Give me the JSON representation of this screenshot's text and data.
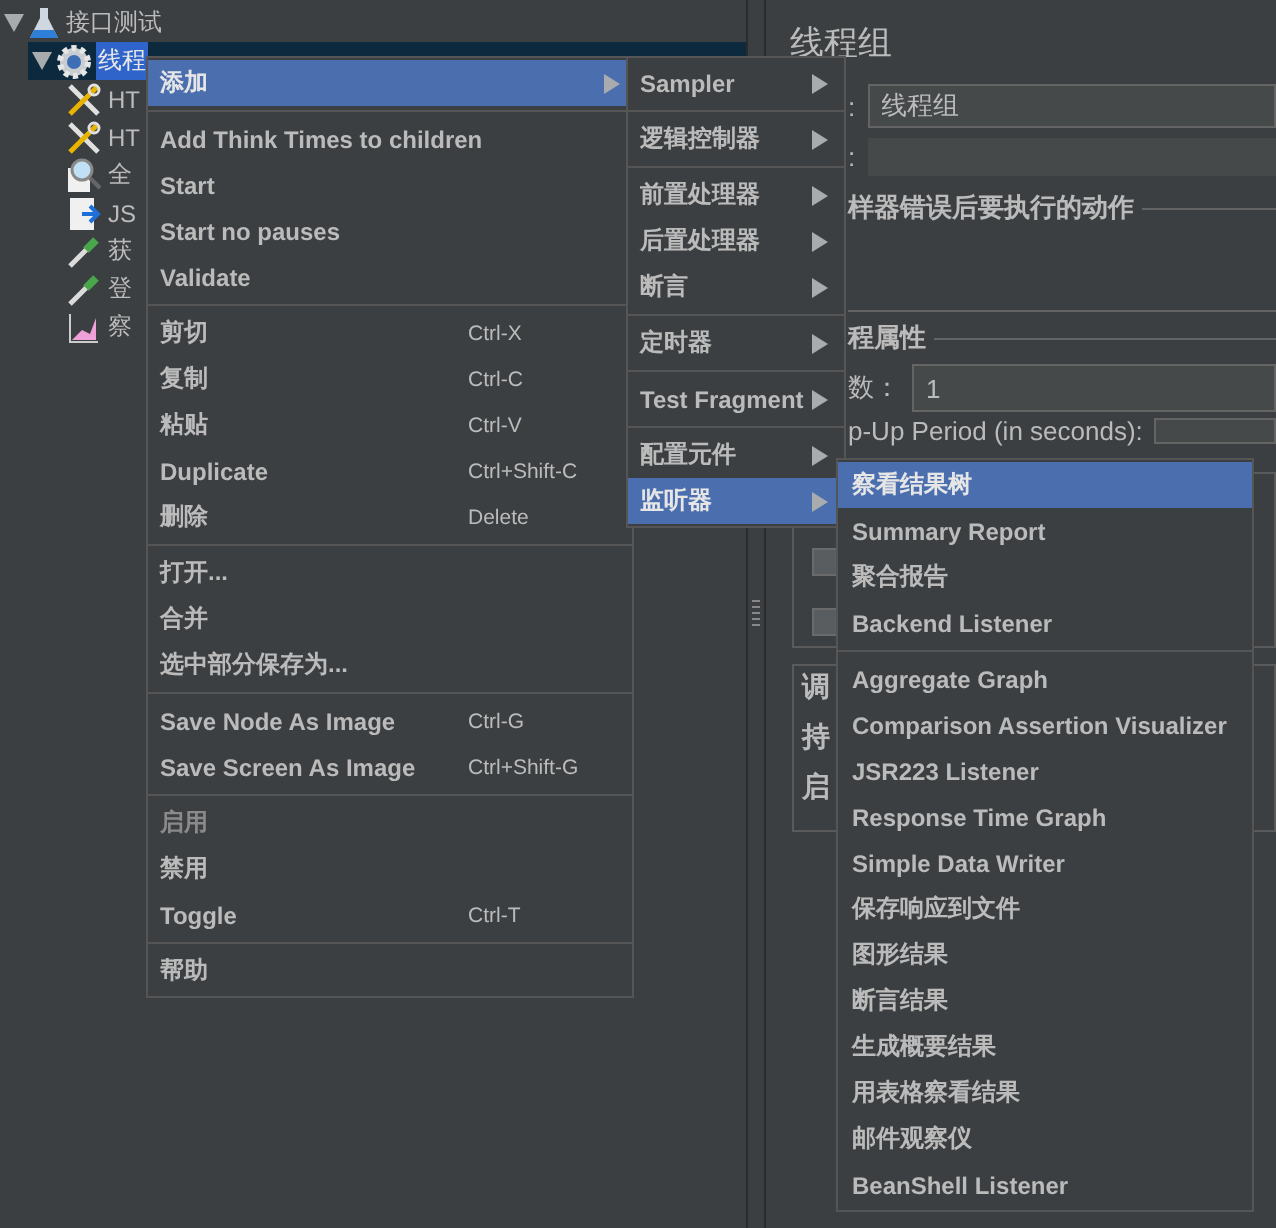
{
  "tree": [
    {
      "label": "接口测试",
      "kind": "plan",
      "expanded": true,
      "selected": false,
      "children": [
        {
          "label": "线程",
          "kind": "thread-group",
          "expanded": true,
          "selected": true,
          "children": [
            {
              "label": "HT",
              "kind": "sampler",
              "selected": false
            },
            {
              "label": "HT",
              "kind": "sampler",
              "selected": false
            },
            {
              "label": "全",
              "kind": "config",
              "selected": false
            },
            {
              "label": "JS",
              "kind": "processor",
              "selected": false
            },
            {
              "label": "获",
              "kind": "extractor",
              "selected": false
            },
            {
              "label": "登",
              "kind": "extractor",
              "selected": false
            },
            {
              "label": "察",
              "kind": "listener",
              "selected": false
            }
          ]
        }
      ]
    }
  ],
  "panel": {
    "title": "线程组",
    "name_label": ":",
    "name_value": "线程组",
    "comment_label": ":",
    "error_section": "样器错误后要执行的动作",
    "props_section": "程属性",
    "threads_label": "数：",
    "threads_value": "1",
    "rampup_label": "p-Up Period (in seconds):",
    "checkboxes": [
      {
        "checked": false
      },
      {
        "checked": false
      }
    ],
    "schedule_labels": [
      "调",
      "持",
      "启"
    ]
  },
  "context_menu": [
    {
      "kind": "item",
      "label": "添加",
      "submenu": true,
      "selected": true,
      "disabled": false
    },
    {
      "kind": "separator"
    },
    {
      "kind": "item",
      "label": "Add Think Times to children",
      "submenu": false,
      "selected": false,
      "disabled": false
    },
    {
      "kind": "item",
      "label": "Start",
      "submenu": false,
      "selected": false,
      "disabled": false
    },
    {
      "kind": "item",
      "label": "Start no pauses",
      "submenu": false,
      "selected": false,
      "disabled": false
    },
    {
      "kind": "item",
      "label": "Validate",
      "submenu": false,
      "selected": false,
      "disabled": false
    },
    {
      "kind": "separator"
    },
    {
      "kind": "item",
      "label": "剪切",
      "shortcut": "Ctrl-X",
      "submenu": false,
      "selected": false,
      "disabled": false
    },
    {
      "kind": "item",
      "label": "复制",
      "shortcut": "Ctrl-C",
      "submenu": false,
      "selected": false,
      "disabled": false
    },
    {
      "kind": "item",
      "label": "粘贴",
      "shortcut": "Ctrl-V",
      "submenu": false,
      "selected": false,
      "disabled": false
    },
    {
      "kind": "item",
      "label": "Duplicate",
      "shortcut": "Ctrl+Shift-C",
      "submenu": false,
      "selected": false,
      "disabled": false
    },
    {
      "kind": "item",
      "label": "删除",
      "shortcut": "Delete",
      "submenu": false,
      "selected": false,
      "disabled": false
    },
    {
      "kind": "separator"
    },
    {
      "kind": "item",
      "label": "打开...",
      "submenu": false,
      "selected": false,
      "disabled": false
    },
    {
      "kind": "item",
      "label": "合并",
      "submenu": false,
      "selected": false,
      "disabled": false
    },
    {
      "kind": "item",
      "label": "选中部分保存为...",
      "submenu": false,
      "selected": false,
      "disabled": false
    },
    {
      "kind": "separator"
    },
    {
      "kind": "item",
      "label": "Save Node As Image",
      "shortcut": "Ctrl-G",
      "submenu": false,
      "selected": false,
      "disabled": false
    },
    {
      "kind": "item",
      "label": "Save Screen As Image",
      "shortcut": "Ctrl+Shift-G",
      "submenu": false,
      "selected": false,
      "disabled": false
    },
    {
      "kind": "separator"
    },
    {
      "kind": "item",
      "label": "启用",
      "submenu": false,
      "selected": false,
      "disabled": true
    },
    {
      "kind": "item",
      "label": "禁用",
      "submenu": false,
      "selected": false,
      "disabled": false
    },
    {
      "kind": "item",
      "label": "Toggle",
      "shortcut": "Ctrl-T",
      "submenu": false,
      "selected": false,
      "disabled": false
    },
    {
      "kind": "separator"
    },
    {
      "kind": "item",
      "label": "帮助",
      "submenu": false,
      "selected": false,
      "disabled": false
    }
  ],
  "add_submenu": [
    {
      "kind": "item",
      "label": "Sampler",
      "submenu": true,
      "selected": false
    },
    {
      "kind": "separator"
    },
    {
      "kind": "item",
      "label": "逻辑控制器",
      "submenu": true,
      "selected": false
    },
    {
      "kind": "separator"
    },
    {
      "kind": "item",
      "label": "前置处理器",
      "submenu": true,
      "selected": false
    },
    {
      "kind": "item",
      "label": "后置处理器",
      "submenu": true,
      "selected": false
    },
    {
      "kind": "item",
      "label": "断言",
      "submenu": true,
      "selected": false
    },
    {
      "kind": "separator"
    },
    {
      "kind": "item",
      "label": "定时器",
      "submenu": true,
      "selected": false
    },
    {
      "kind": "separator"
    },
    {
      "kind": "item",
      "label": "Test Fragment",
      "submenu": true,
      "selected": false
    },
    {
      "kind": "separator"
    },
    {
      "kind": "item",
      "label": "配置元件",
      "submenu": true,
      "selected": false
    },
    {
      "kind": "item",
      "label": "监听器",
      "submenu": true,
      "selected": true
    }
  ],
  "listener_submenu": [
    {
      "kind": "item",
      "label": "察看结果树",
      "selected": true
    },
    {
      "kind": "item",
      "label": "Summary Report",
      "selected": false
    },
    {
      "kind": "item",
      "label": "聚合报告",
      "selected": false
    },
    {
      "kind": "item",
      "label": "Backend Listener",
      "selected": false
    },
    {
      "kind": "separator"
    },
    {
      "kind": "item",
      "label": "Aggregate Graph",
      "selected": false
    },
    {
      "kind": "item",
      "label": "Comparison Assertion Visualizer",
      "selected": false
    },
    {
      "kind": "item",
      "label": "JSR223 Listener",
      "selected": false
    },
    {
      "kind": "item",
      "label": "Response Time Graph",
      "selected": false
    },
    {
      "kind": "item",
      "label": "Simple Data Writer",
      "selected": false
    },
    {
      "kind": "item",
      "label": "保存响应到文件",
      "selected": false
    },
    {
      "kind": "item",
      "label": "图形结果",
      "selected": false
    },
    {
      "kind": "item",
      "label": "断言结果",
      "selected": false
    },
    {
      "kind": "item",
      "label": "生成概要结果",
      "selected": false
    },
    {
      "kind": "item",
      "label": "用表格察看结果",
      "selected": false
    },
    {
      "kind": "item",
      "label": "邮件观察仪",
      "selected": false
    },
    {
      "kind": "item",
      "label": "BeanShell Listener",
      "selected": false
    }
  ]
}
